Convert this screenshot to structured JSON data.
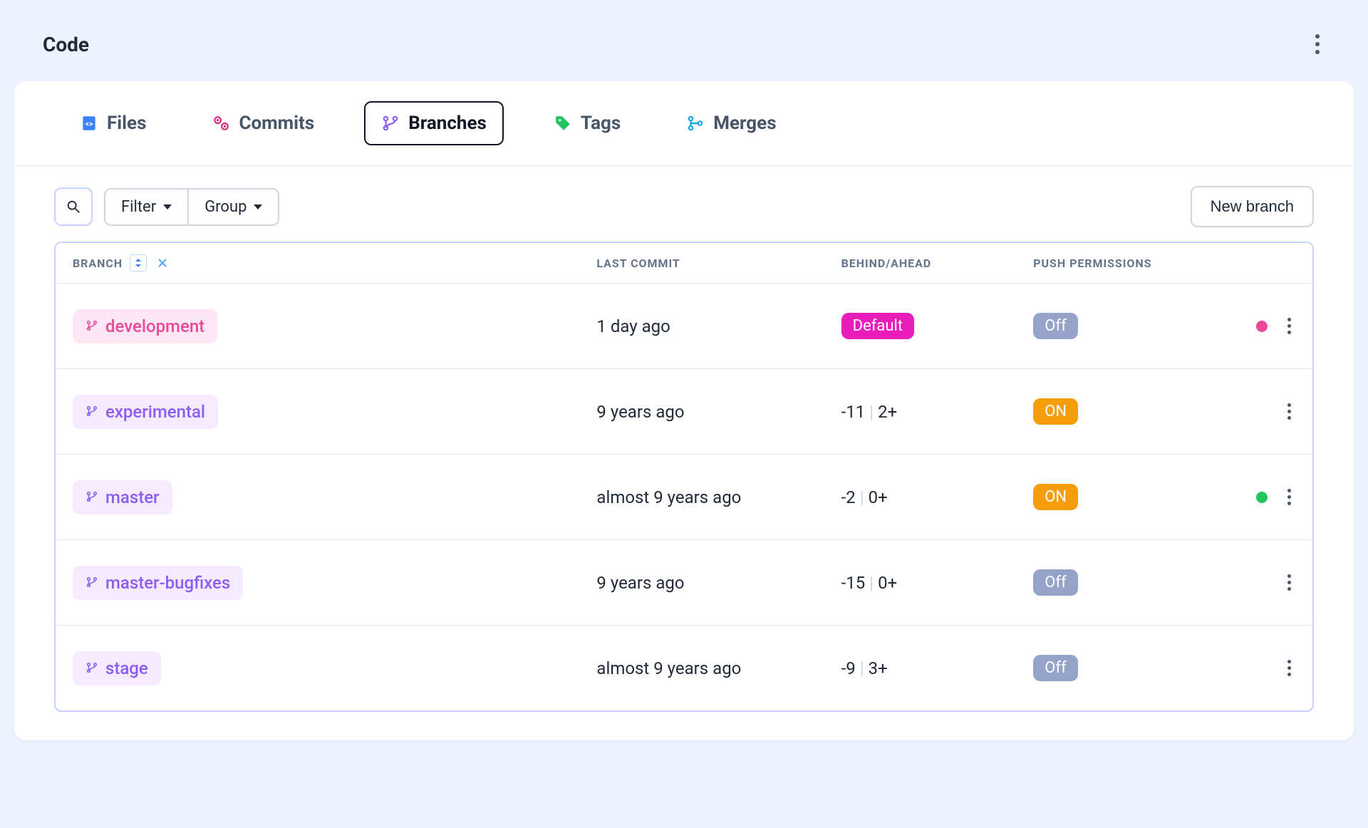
{
  "header": {
    "title": "Code"
  },
  "tabs": [
    {
      "label": "Files"
    },
    {
      "label": "Commits"
    },
    {
      "label": "Branches"
    },
    {
      "label": "Tags"
    },
    {
      "label": "Merges"
    }
  ],
  "toolbar": {
    "filter": "Filter",
    "group": "Group",
    "new_branch": "New branch"
  },
  "columns": {
    "branch": "BRANCH",
    "last_commit": "LAST COMMIT",
    "behind_ahead": "BEHIND/AHEAD",
    "push_permissions": "PUSH PERMISSIONS"
  },
  "rows": [
    {
      "name": "development",
      "style": "pink",
      "last_commit": "1 day ago",
      "behind_ahead_type": "default",
      "default_label": "Default",
      "permission": "Off",
      "dot": "pink"
    },
    {
      "name": "experimental",
      "style": "purple",
      "last_commit": "9 years ago",
      "behind_ahead_type": "value",
      "behind": "-11",
      "ahead": "2+",
      "permission": "ON",
      "dot": ""
    },
    {
      "name": "master",
      "style": "purple",
      "last_commit": "almost 9 years ago",
      "behind_ahead_type": "value",
      "behind": "-2",
      "ahead": "0+",
      "permission": "ON",
      "dot": "green"
    },
    {
      "name": "master-bugfixes",
      "style": "purple",
      "last_commit": "9 years ago",
      "behind_ahead_type": "value",
      "behind": "-15",
      "ahead": "0+",
      "permission": "Off",
      "dot": ""
    },
    {
      "name": "stage",
      "style": "purple",
      "last_commit": "almost 9 years ago",
      "behind_ahead_type": "value",
      "behind": "-9",
      "ahead": "3+",
      "permission": "Off",
      "dot": ""
    }
  ]
}
